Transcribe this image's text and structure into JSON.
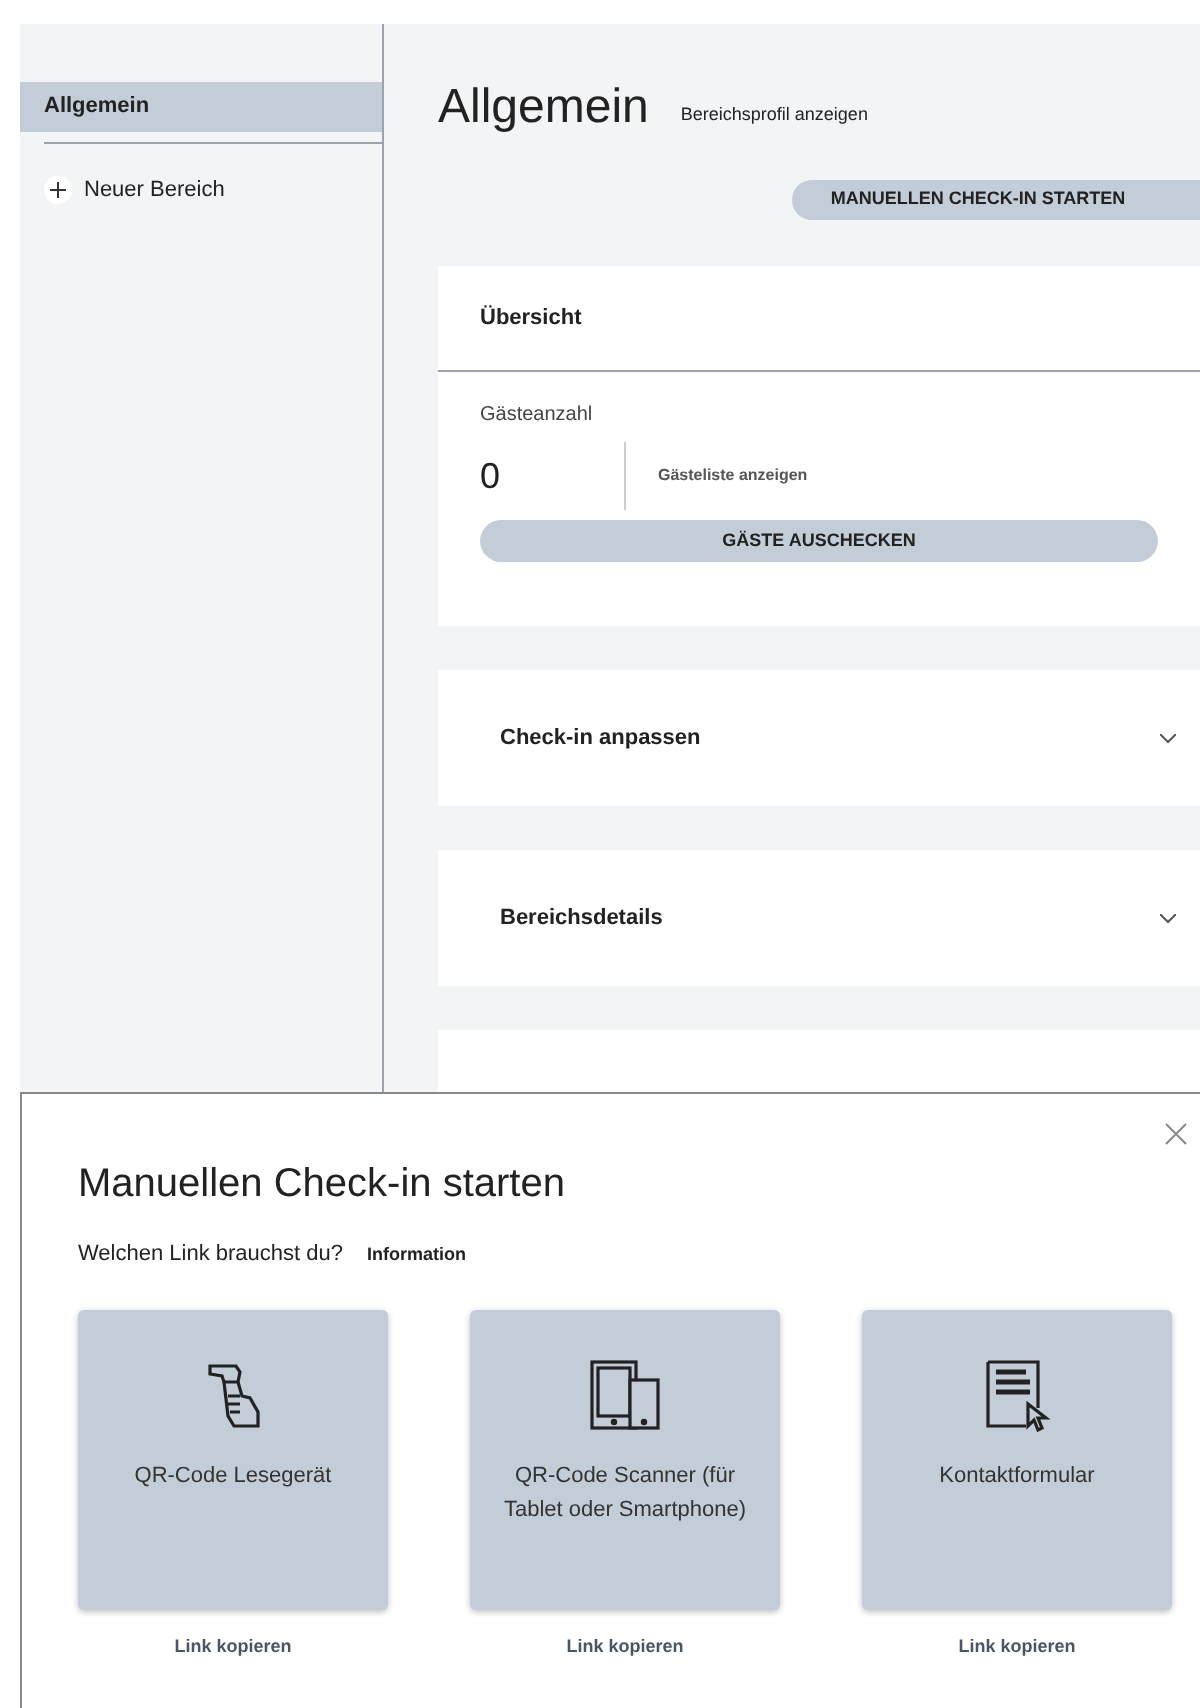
{
  "sidebar": {
    "items": [
      {
        "label": "Allgemein",
        "selected": true
      }
    ],
    "add_button": "Neuer Bereich"
  },
  "main": {
    "title": "Allgemein",
    "profile_link": "Bereichsprofil anzeigen",
    "checkin_button": "MANUELLEN CHECK-IN STARTEN",
    "overview": {
      "title": "Übersicht",
      "guest_count_label": "Gästeanzahl",
      "guest_count": "0",
      "guest_list_link": "Gästeliste anzeigen",
      "checkout_button": "GÄSTE AUSCHECKEN"
    },
    "sections": [
      {
        "title": "Check-in anpassen",
        "expanded": false
      },
      {
        "title": "Bereichsdetails",
        "expanded": false
      }
    ]
  },
  "dialog": {
    "title": "Manuellen Check-in starten",
    "question": "Welchen Link brauchst du?",
    "info_link": "Information",
    "options": [
      {
        "kind": "scanner",
        "label": "QR-Code Lesegerät",
        "link": "Link kopieren"
      },
      {
        "kind": "devices",
        "label": "QR-Code Scanner (für Tablet oder Smartphone)",
        "link": "Link kopieren"
      },
      {
        "kind": "form",
        "label": "Kontaktformular",
        "link": "Link kopieren"
      }
    ]
  }
}
